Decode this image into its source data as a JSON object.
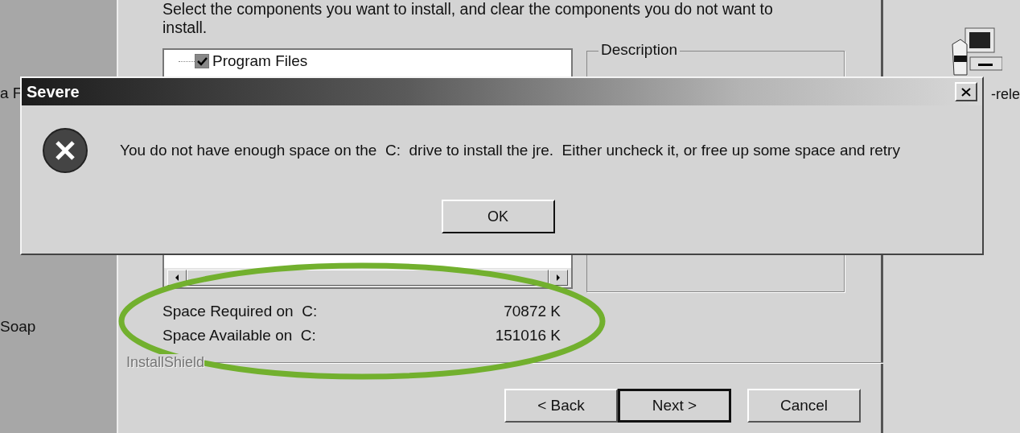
{
  "desktop": {
    "left_labels": [
      "a F",
      "Soap"
    ],
    "right_labels": [
      "-rele"
    ]
  },
  "installer": {
    "instruction": "Select the components you want to install, and clear the components you do not want to install.",
    "components": [
      {
        "label": "Program Files",
        "checked": true
      }
    ],
    "description_title": "Description",
    "space": [
      {
        "label": "Space Required on  C:",
        "value": "70872 K"
      },
      {
        "label": "Space Available on  C:",
        "value": "151016 K"
      }
    ],
    "brand": "InstallShield",
    "buttons": [
      {
        "label": "< Back",
        "default": false
      },
      {
        "label": "Next >",
        "default": true
      },
      {
        "label": "Cancel",
        "default": false
      }
    ]
  },
  "dialog": {
    "title": "Severe",
    "message": "You do not have enough space on the  C:  drive to install the jre.  Either uncheck it, or free up some space and retry",
    "button": "OK"
  }
}
